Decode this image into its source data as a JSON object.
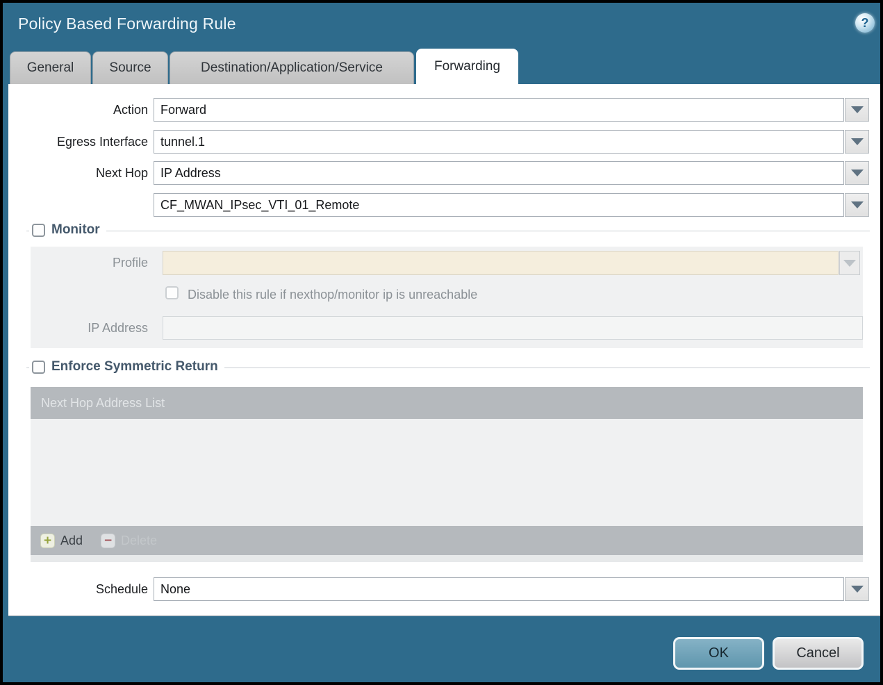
{
  "window": {
    "title": "Policy Based Forwarding Rule",
    "help_glyph": "?"
  },
  "tabs": [
    {
      "label": "General",
      "active": false
    },
    {
      "label": "Source",
      "active": false
    },
    {
      "label": "Destination/Application/Service",
      "active": false
    },
    {
      "label": "Forwarding",
      "active": true
    }
  ],
  "form": {
    "action": {
      "label": "Action",
      "value": "Forward"
    },
    "egress_interface": {
      "label": "Egress Interface",
      "value": "tunnel.1"
    },
    "next_hop": {
      "label": "Next Hop",
      "value": "IP Address"
    },
    "next_hop_address": {
      "value": "CF_MWAN_IPsec_VTI_01_Remote"
    },
    "schedule": {
      "label": "Schedule",
      "value": "None"
    }
  },
  "monitor": {
    "legend": "Monitor",
    "checked": false,
    "profile": {
      "label": "Profile",
      "value": ""
    },
    "disable_rule": {
      "label": "Disable this rule if nexthop/monitor ip is unreachable",
      "checked": false
    },
    "ip_address": {
      "label": "IP Address",
      "value": ""
    }
  },
  "symmetric_return": {
    "legend": "Enforce Symmetric Return",
    "checked": false,
    "table": {
      "header": "Next Hop Address List",
      "rows": []
    },
    "add": {
      "label": "Add",
      "icon_glyph": "+"
    },
    "delete": {
      "label": "Delete",
      "icon_glyph": "−",
      "disabled": true
    }
  },
  "footer": {
    "ok": "OK",
    "cancel": "Cancel"
  },
  "colors": {
    "chrome_teal": "#2e6b8c",
    "ok_button": "#6fa3ba",
    "profile_field_bg": "#f5eedd",
    "table_header_bg": "#b5b9bd",
    "legend_text": "#44586b"
  }
}
